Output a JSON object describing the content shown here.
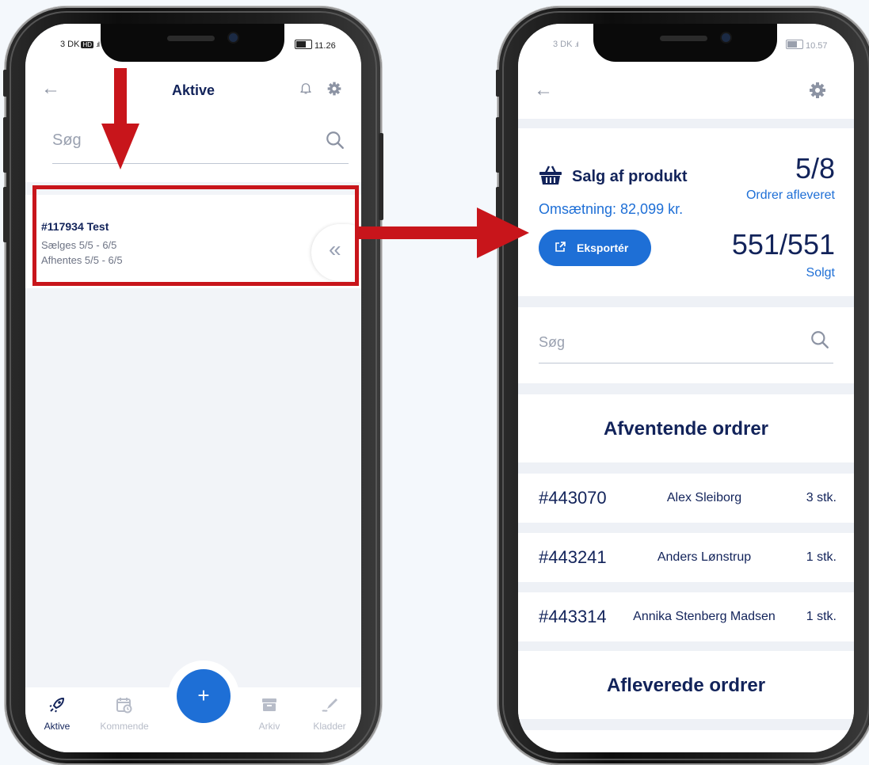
{
  "left": {
    "status": {
      "carrier": "3 DK",
      "network": "HD",
      "time": "11.26"
    },
    "header": {
      "back_icon": "arrow-left-icon",
      "title": "Aktive",
      "bell_icon": "bell-icon",
      "gear_icon": "gear-icon"
    },
    "search": {
      "placeholder": "Søg"
    },
    "order": {
      "id": "#117934 Test",
      "sell": "Sælges 5/5 - 6/5",
      "pickup": "Afhentes 5/5 - 6/5",
      "swipe_icon": "double-chevron-left-icon"
    },
    "fab": {
      "label": "+"
    },
    "tabs": [
      {
        "label": "Aktive",
        "icon": "rocket-icon",
        "active": true
      },
      {
        "label": "Kommende",
        "icon": "calendar-clock-icon",
        "active": false
      },
      {
        "label": "Arkiv",
        "icon": "archive-icon",
        "active": false
      },
      {
        "label": "Kladder",
        "icon": "pen-icon",
        "active": false
      }
    ]
  },
  "right": {
    "status": {
      "carrier": "3 DK",
      "time": "10.57"
    },
    "header": {
      "back_icon": "arrow-left-icon",
      "gear_icon": "gear-icon"
    },
    "summary": {
      "product": "Salg af produkt",
      "revenue": "Omsætning: 82,099 kr.",
      "export_label": "Eksportér",
      "delivered_value": "5/8",
      "delivered_label": "Ordrer afleveret",
      "sold_value": "551/551",
      "sold_label": "Solgt"
    },
    "search": {
      "placeholder": "Søg"
    },
    "pending_title": "Afventende ordrer",
    "pending_orders": [
      {
        "id": "#443070",
        "name": "Alex Sleiborg",
        "qty": "3 stk."
      },
      {
        "id": "#443241",
        "name": "Anders Lønstrup",
        "qty": "1 stk."
      },
      {
        "id": "#443314",
        "name": "Annika Stenberg Madsen",
        "qty": "1 stk."
      }
    ],
    "delivered_title": "Afleverede ordrer"
  },
  "colors": {
    "navy": "#12235a",
    "blue": "#1e6fd6",
    "annotation_red": "#c8151b",
    "background": "#f2f4f8"
  }
}
